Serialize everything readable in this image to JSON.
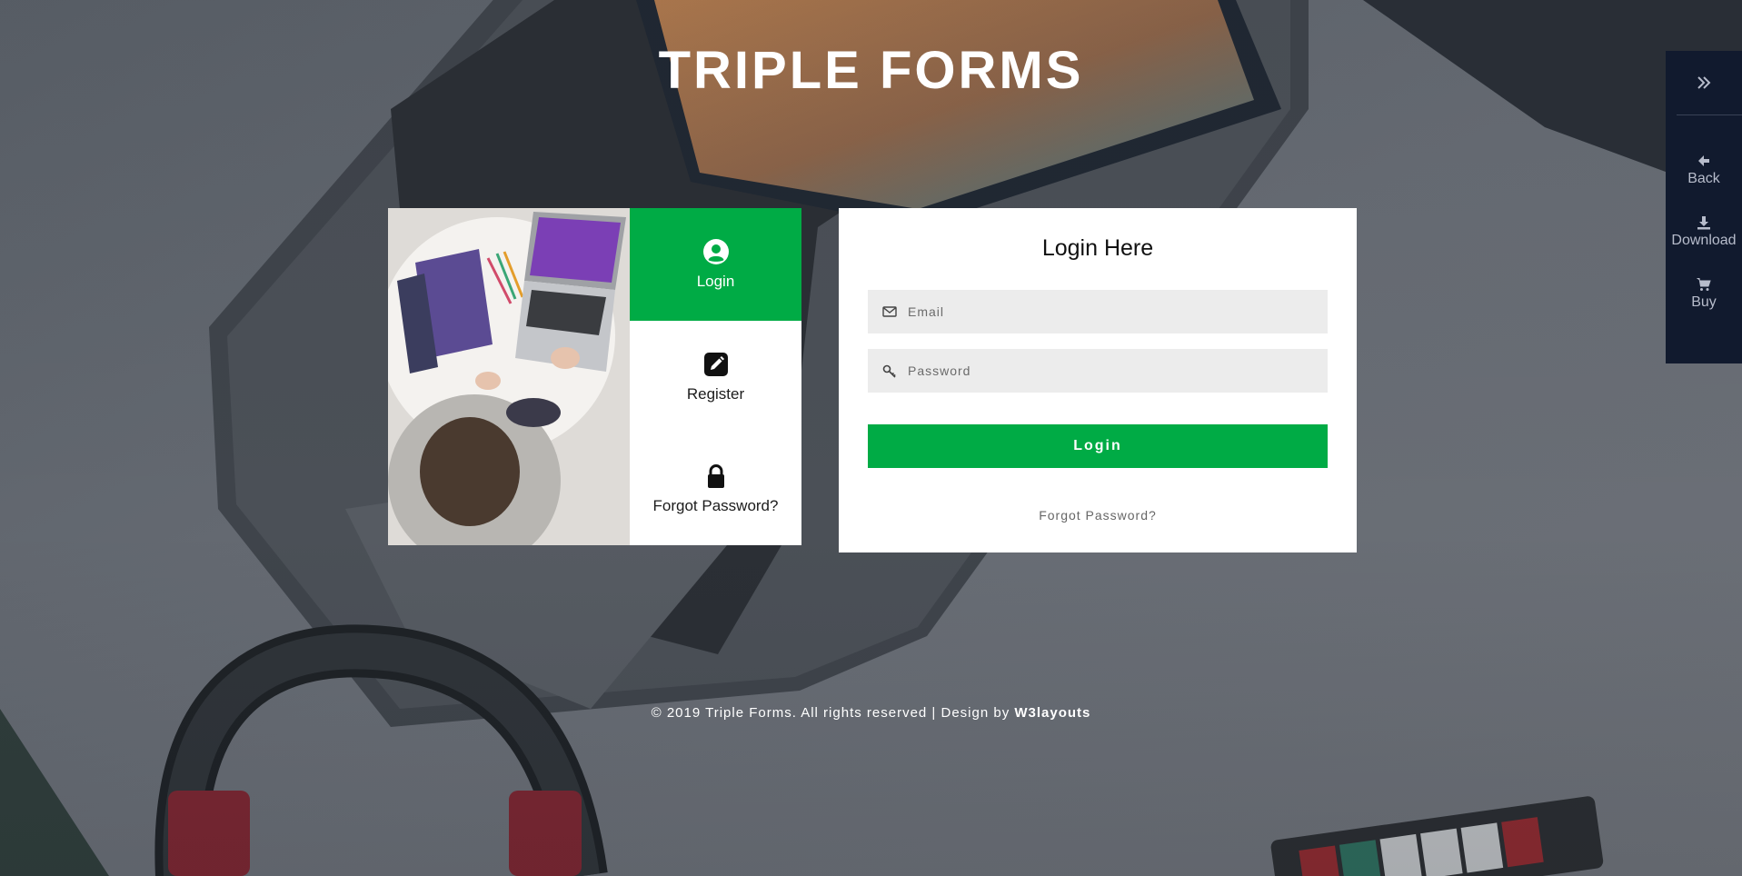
{
  "header": {
    "title": "TRIPLE FORMS"
  },
  "tabs": [
    {
      "label": "Login",
      "icon": "user-circle-icon",
      "active": true
    },
    {
      "label": "Register",
      "icon": "pencil-square-icon",
      "active": false
    },
    {
      "label": "Forgot Password?",
      "icon": "lock-icon",
      "active": false
    }
  ],
  "login_form": {
    "title": "Login Here",
    "email_placeholder": "Email",
    "password_placeholder": "Password",
    "submit_label": "Login",
    "forgot_label": "Forgot Password?"
  },
  "footer": {
    "text": "© 2019 Triple Forms. All rights reserved | Design by ",
    "link": "W3layouts"
  },
  "demo_bar": {
    "items": [
      {
        "label": "Back",
        "icon": "arrow-left-icon"
      },
      {
        "label": "Download",
        "icon": "download-icon"
      },
      {
        "label": "Buy",
        "icon": "cart-icon"
      }
    ]
  },
  "colors": {
    "accent": "#00ab45",
    "sidebar": "#111a2e",
    "panel": "#ffffff"
  }
}
